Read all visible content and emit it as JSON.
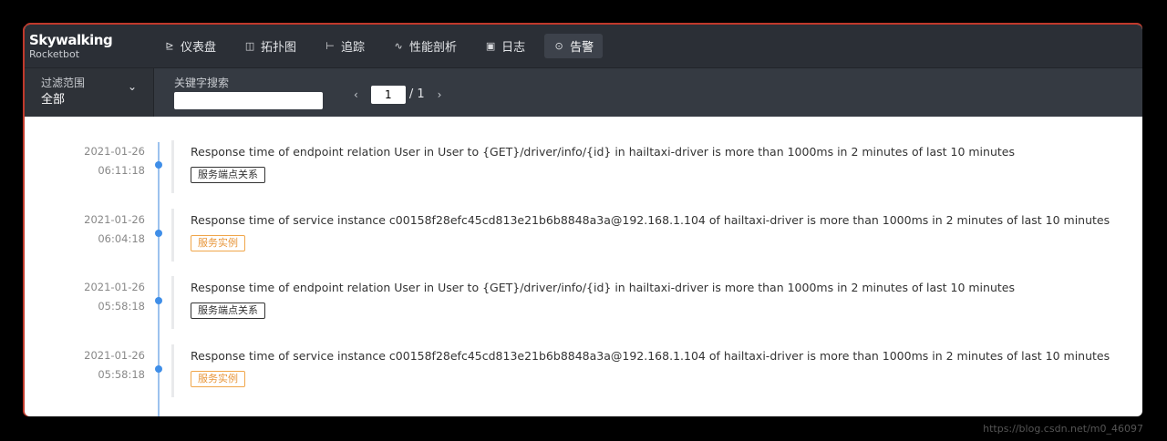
{
  "brand": {
    "name": "Skywalking",
    "sub": "Rocketbot"
  },
  "nav": [
    {
      "label": "仪表盘",
      "icon": "dashboard-icon",
      "glyph": "⊵",
      "active": false
    },
    {
      "label": "拓扑图",
      "icon": "topology-icon",
      "glyph": "◫",
      "active": false
    },
    {
      "label": "追踪",
      "icon": "trace-icon",
      "glyph": "⊢",
      "active": false
    },
    {
      "label": "性能剖析",
      "icon": "profile-icon",
      "glyph": "∿",
      "active": false
    },
    {
      "label": "日志",
      "icon": "log-icon",
      "glyph": "▣",
      "active": false
    },
    {
      "label": "告警",
      "icon": "alarm-icon",
      "glyph": "⊙",
      "active": true
    }
  ],
  "filter": {
    "scope_label": "过滤范围",
    "scope_value": "全部",
    "keyword_label": "关键字搜索",
    "keyword_value": "",
    "page_current": "1",
    "page_total": "/ 1"
  },
  "alarms": [
    {
      "date": "2021-01-26",
      "time": "06:11:18",
      "message": "Response time of endpoint relation User in User to {GET}/driver/info/{id} in hailtaxi-driver is more than 1000ms in 2 minutes of last 10 minutes",
      "tag": "服务端点关系",
      "tag_style": "dark"
    },
    {
      "date": "2021-01-26",
      "time": "06:04:18",
      "message": "Response time of service instance c00158f28efc45cd813e21b6b8848a3a@192.168.1.104 of hailtaxi-driver is more than 1000ms in 2 minutes of last 10 minutes",
      "tag": "服务实例",
      "tag_style": "orange"
    },
    {
      "date": "2021-01-26",
      "time": "05:58:18",
      "message": "Response time of endpoint relation User in User to {GET}/driver/info/{id} in hailtaxi-driver is more than 1000ms in 2 minutes of last 10 minutes",
      "tag": "服务端点关系",
      "tag_style": "dark"
    },
    {
      "date": "2021-01-26",
      "time": "05:58:18",
      "message": "Response time of service instance c00158f28efc45cd813e21b6b8848a3a@192.168.1.104 of hailtaxi-driver is more than 1000ms in 2 minutes of last 10 minutes",
      "tag": "服务实例",
      "tag_style": "orange"
    }
  ],
  "watermark": "https://blog.csdn.net/m0_46097"
}
